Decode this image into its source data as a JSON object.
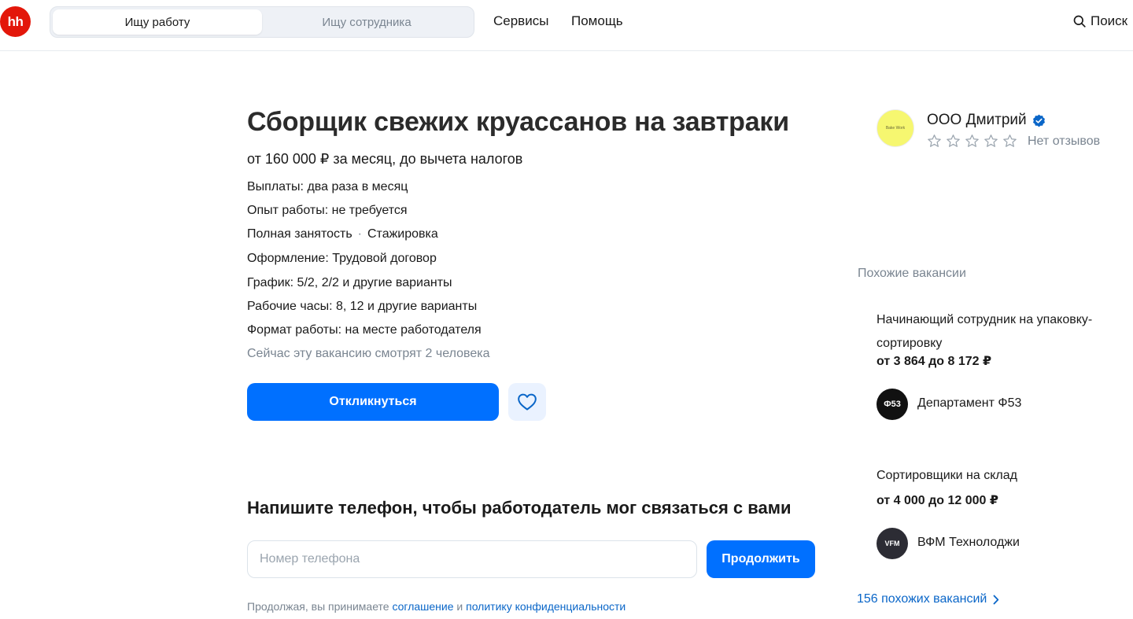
{
  "header": {
    "logo_text": "hh",
    "switcher": {
      "seek_job": "Ищу работу",
      "seek_employee": "Ищу сотрудника"
    },
    "nav": {
      "services": "Сервисы",
      "help": "Помощь"
    },
    "search_label": "Поиск"
  },
  "vacancy": {
    "title": "Сборщик свежих круассанов на завтраки",
    "salary": "от 160 000 ₽ за месяц, до вычета налогов",
    "payments": "Выплаты: два раза в месяц",
    "experience": "Опыт работы: не требуется",
    "employment": "Полная занятость",
    "employment_extra": "Стажировка",
    "contract": "Оформление: Трудовой договор",
    "schedule": "График: 5/2, 2/2 и другие варианты",
    "hours": "Рабочие часы: 8, 12 и другие варианты",
    "format": "Формат работы: на месте работодателя",
    "viewers": "Сейчас эту вакансию смотрят 2 человека",
    "apply_label": "Откликнуться"
  },
  "phone_form": {
    "heading": "Напишите телефон, чтобы работодатель мог связаться с вами",
    "placeholder": "Номер телефона",
    "continue_label": "Продолжить",
    "agreement_prefix": "Продолжая, вы принимаете",
    "agreement_link": "соглашение",
    "agreement_and": "и",
    "privacy_link": "политику конфиденциальности"
  },
  "company": {
    "name": "ООО Дмитрий",
    "logo_text": "Bake Work",
    "rating_stars": 0,
    "reviews": "Нет отзывов"
  },
  "similar": {
    "title": "Похожие вакансии",
    "items": [
      {
        "title": "Начинающий сотрудник на упаковку-сортировку",
        "salary": "от 3 864 до 8 172 ₽",
        "company": "Департамент Ф53",
        "logo_text": "Ф53"
      },
      {
        "title": "Сортировщики на склад",
        "salary": "от 4 000 до 12 000 ₽",
        "company": "ВФМ Технолоджи",
        "logo_text": "VFM"
      }
    ],
    "more_link": "156 похожих вакансий"
  },
  "colors": {
    "brand_red": "#e3170a",
    "accent_blue": "#0070ff",
    "link_blue": "#0a66c8",
    "muted_text": "#7a8591"
  }
}
